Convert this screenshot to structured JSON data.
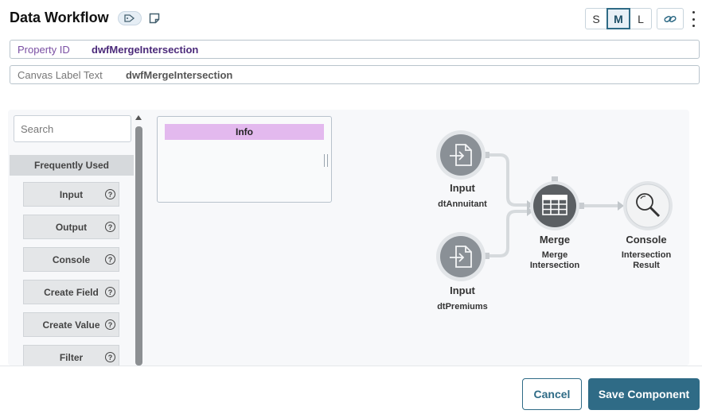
{
  "header": {
    "title": "Data Workflow",
    "size_options": [
      "S",
      "M",
      "L"
    ],
    "size_selected": "M"
  },
  "fields": {
    "property_id": {
      "label": "Property ID",
      "value": "dwfMergeIntersection"
    },
    "canvas_label": {
      "label": "Canvas Label Text",
      "value": "dwfMergeIntersection"
    }
  },
  "palette": {
    "search_placeholder": "Search",
    "section_title": "Frequently Used",
    "items": [
      "Input",
      "Output",
      "Console",
      "Create Field",
      "Create Value",
      "Filter"
    ]
  },
  "canvas": {
    "info_title": "Info",
    "nodes": [
      {
        "id": "input1",
        "type": "Input",
        "label": "dtAnnuitant",
        "icon": "input-icon"
      },
      {
        "id": "input2",
        "type": "Input",
        "label": "dtPremiums",
        "icon": "input-icon"
      },
      {
        "id": "merge",
        "type": "Merge",
        "label_line1": "Merge",
        "label_line2": "Intersection",
        "icon": "table-icon"
      },
      {
        "id": "console",
        "type": "Console",
        "label_line1": "Intersection",
        "label_line2": "Result",
        "icon": "magnifier-icon"
      }
    ]
  },
  "footer": {
    "cancel_label": "Cancel",
    "save_label": "Save Component"
  },
  "colors": {
    "accent": "#2f6b86",
    "info_header": "#e3b9ee",
    "property_label": "#7a4fa3"
  }
}
